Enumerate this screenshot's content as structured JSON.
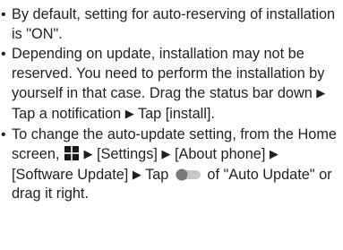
{
  "notes": [
    {
      "text": "By default, setting for auto-reserving of installation is \"ON\"."
    },
    {
      "text_a": "Depending on update, installation may not be reserved. You need to perform the installation by yourself in that case. Drag the status bar down",
      "arrow": "▶",
      "text_b": "Tap a notification",
      "text_c": "Tap [install]."
    },
    {
      "text_a": "To change the auto-update setting, from the Home screen,",
      "apps_icon": "apps-grid-icon",
      "step_1": "[Settings]",
      "step_2": "[About phone]",
      "step_3": "[Software Update]",
      "step_4": "Tap",
      "toggle_icon": "toggle-switch-icon",
      "text_b": "of \"Auto Update\" or drag it right."
    }
  ],
  "colors": {
    "text": "#231f20",
    "icon_dark": "#1a1a1a",
    "toggle_track": "#c8c8c8",
    "toggle_knob": "#7a7a7a"
  }
}
